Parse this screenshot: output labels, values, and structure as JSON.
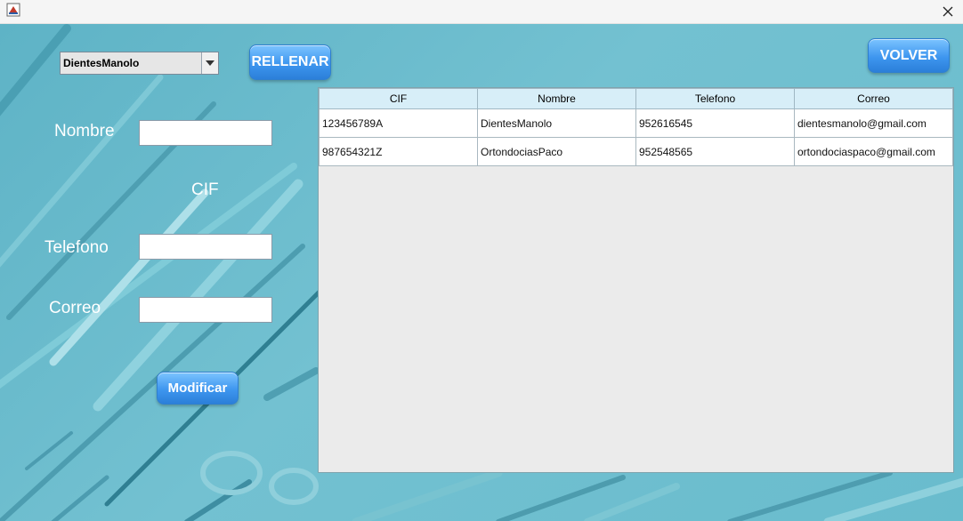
{
  "window": {
    "icon": "java-app-icon",
    "close_icon": "close-icon"
  },
  "combo": {
    "selected": "DientesManolo",
    "icon": "chevron-down-icon"
  },
  "buttons": {
    "rellenar": "RELLENAR",
    "volver": "VOLVER",
    "modificar": "Modificar"
  },
  "form": {
    "nombre_label": "Nombre",
    "cif_label": "CIF",
    "telefono_label": "Telefono",
    "correo_label": "Correo",
    "nombre_value": "",
    "telefono_value": "",
    "correo_value": ""
  },
  "table": {
    "columns": [
      "CIF",
      "Nombre",
      "Telefono",
      "Correo"
    ],
    "rows": [
      [
        "123456789A",
        "DientesManolo",
        "952616545",
        "dientesmanolo@gmail.com"
      ],
      [
        "987654321Z",
        "OrtondociasPaco",
        "952548565",
        "ortondociaspaco@gmail.com"
      ]
    ]
  },
  "colors": {
    "background": "#6cb9c9",
    "button": "#3e96ef",
    "header": "#d7eef8"
  }
}
